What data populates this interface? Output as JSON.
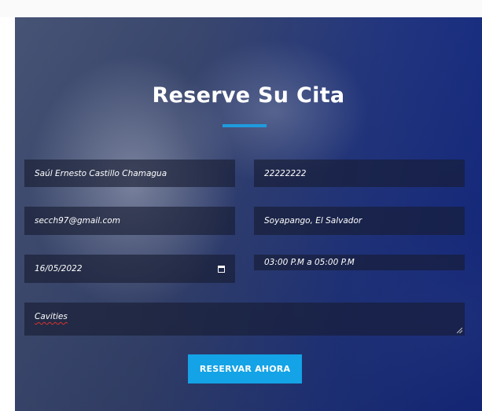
{
  "form": {
    "title": "Reserve Su Cita",
    "accent_color": "#1e9bde",
    "fields": {
      "name": "Saúl Ernesto Castillo Chamagua",
      "phone": "22222222",
      "email": "secch97@gmail.com",
      "city": "Soyapango, El Salvador",
      "date": "16/05/2022",
      "time": "03:00 P.M a 05:00 P.M",
      "notes": "Cavities"
    },
    "submit_label": "RESERVAR AHORA",
    "button_color": "#13a3e6"
  }
}
